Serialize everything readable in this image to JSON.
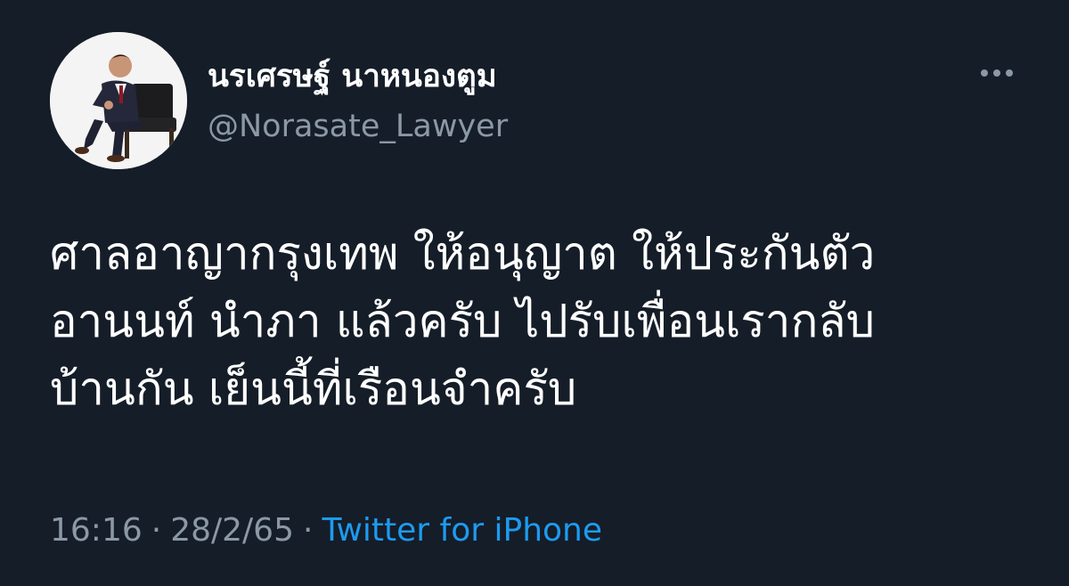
{
  "author": {
    "display_name": "นรเศรษฐ์ นาหนองตูม",
    "handle": "@Norasate_Lawyer",
    "avatar_icon": "profile-photo-man-in-suit-on-chair"
  },
  "tweet": {
    "text_lines": [
      "ศาลอาญากรุงเทพ ให้อนุญาต ให้ประกันตัว",
      "อานนท์ นำภา แล้วครับ ไปรับเพื่อนเรากลับ",
      "บ้านกัน เย็นนี้ที่เรือนจำครับ"
    ]
  },
  "meta": {
    "time": "16:16",
    "separator": "·",
    "date": "28/2/65",
    "source": "Twitter for iPhone"
  },
  "colors": {
    "background": "#151d28",
    "text_primary": "#ffffff",
    "text_secondary": "#8b98a5",
    "link": "#1d9bf0"
  },
  "icons": {
    "more": "more-horizontal-icon"
  }
}
